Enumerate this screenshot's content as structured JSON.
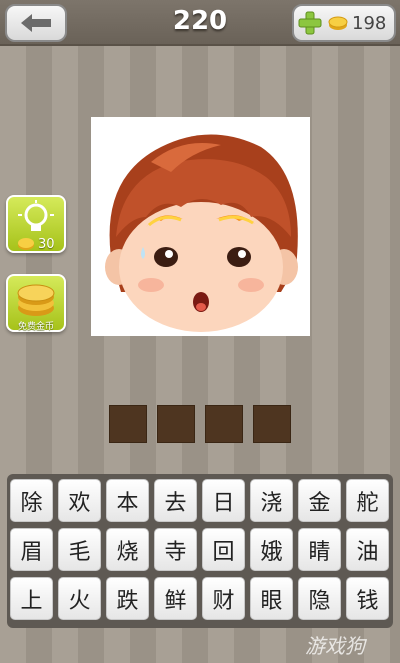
{
  "header": {
    "level": "220",
    "coins": "198"
  },
  "hint": {
    "cost": "30"
  },
  "free_coins": {
    "label": "免费金币"
  },
  "answer_slot_count": 4,
  "keyboard": [
    [
      "除",
      "欢",
      "本",
      "去",
      "日",
      "浇",
      "金",
      "舵"
    ],
    [
      "眉",
      "毛",
      "烧",
      "寺",
      "回",
      "娥",
      "睛",
      "油"
    ],
    [
      "上",
      "火",
      "跌",
      "鲜",
      "财",
      "眼",
      "隐",
      "钱"
    ]
  ],
  "watermark": "游戏狗",
  "colors": {
    "accent_green": "#b5d12e",
    "slot_brown": "#4e3520",
    "hair": "#b0451f"
  }
}
